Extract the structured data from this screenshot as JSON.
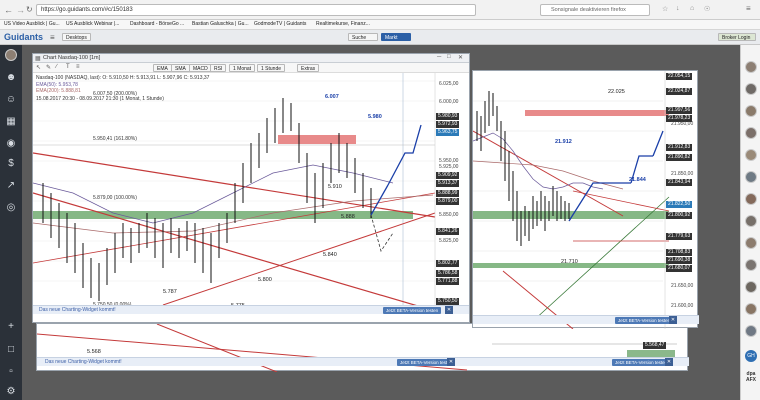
{
  "browser": {
    "url": "https://go.guidants.com/#c/150183",
    "notification": "Sonsignale deaktivieren firefox",
    "bookmarks": [
      "US Video Ausblick | Gu...",
      "US Ausblick Webinar |...",
      "Dashboard - BörseGo ...",
      "Bastian Galuschka | Gu...",
      "GodmodeTV | Guidants",
      "Realtimekurse, Finanz..."
    ]
  },
  "app": {
    "logo": "Guidants",
    "desktop_label": "Desktops",
    "search_label": "Suche",
    "markt_label": "Markt",
    "broker_label": "Broker Login"
  },
  "left_window": {
    "title": "Chart Nasdaq-100 [1m]",
    "toolbar": [
      "EMA",
      "SMA",
      "MACD",
      "RSI",
      "1 Monat",
      "1 Stunde",
      "Extras"
    ],
    "instrument": "Nasdaq-100 (NASDAQ, last): O: 5.910,50  H: 5.913,91  L: 5.907,96  C: 5.913,37",
    "ema50": "EMA(50): 5.953,78",
    "ema200": "EMA(200): 5.888,81",
    "note": "6.007,50 (200.00%)",
    "date_range": "15.08.2017 20:30 - 08.09.2017 21:30  (1 Monat, 1 Stunde)",
    "fib_161": "5.950,41 (161.80%)",
    "fib_100": "5.879,00 (100.00%)",
    "fib_0": "5.750,50 (0.00%)",
    "levels": [
      "6.007",
      "5.980",
      "5.910",
      "5.888",
      "5.840",
      "5.800",
      "5.787",
      "5.775"
    ],
    "axis": [
      "6.025,00",
      "6.000,00",
      "5.975,00",
      "5.950,00",
      "5.925,00",
      "5.900,00",
      "5.875,00",
      "5.850,00",
      "5.825,00",
      "5.800,00",
      "5.775,00",
      "5.750,00"
    ],
    "price_boxes": [
      "5.980,93",
      "5.972,93",
      "5.963,75",
      "5.909,92",
      "5.913,37",
      "5.888,99",
      "5.879,00",
      "5.841,26",
      "5.802,77",
      "5.786,58",
      "5.771,88",
      "5.750,50"
    ],
    "notice": "Das neue Charting-Widget kommt!",
    "beta": "Jetzt BETA-Version testen"
  },
  "right_window": {
    "levels": [
      "22.025",
      "21.912",
      "21.844",
      "21.710",
      "21.950,00"
    ],
    "axis": [
      "22.025,00",
      "22.000,00",
      "21.950,00",
      "21.900,00",
      "21.850,00",
      "21.800,00",
      "21.750,00",
      "21.700,00",
      "21.650,00",
      "21.600,00"
    ],
    "price_boxes": [
      "22.054,15",
      "22.024,87",
      "21.997,56",
      "21.978,23",
      "21.912,83",
      "21.890,82",
      "21.843,94",
      "21.822,50",
      "21.800,92",
      "21.779,63",
      "21.708,83",
      "21.690,38",
      "21.680,07",
      "21.000,00"
    ],
    "notice": "Das neue Charting-Widget kommt!",
    "beta": "Jetzt BETA-Version testen"
  },
  "bottom_window": {
    "levels": [
      "5.568"
    ],
    "price_boxes": [
      "5.568,47"
    ],
    "axis": [
      "29.50,00"
    ],
    "notice": "Das neue Charting-Widget kommt!",
    "beta": "Jetzt BETA-Version testen"
  },
  "sidebar_right": {
    "labels": [
      "GH",
      "dpa AFX"
    ]
  }
}
